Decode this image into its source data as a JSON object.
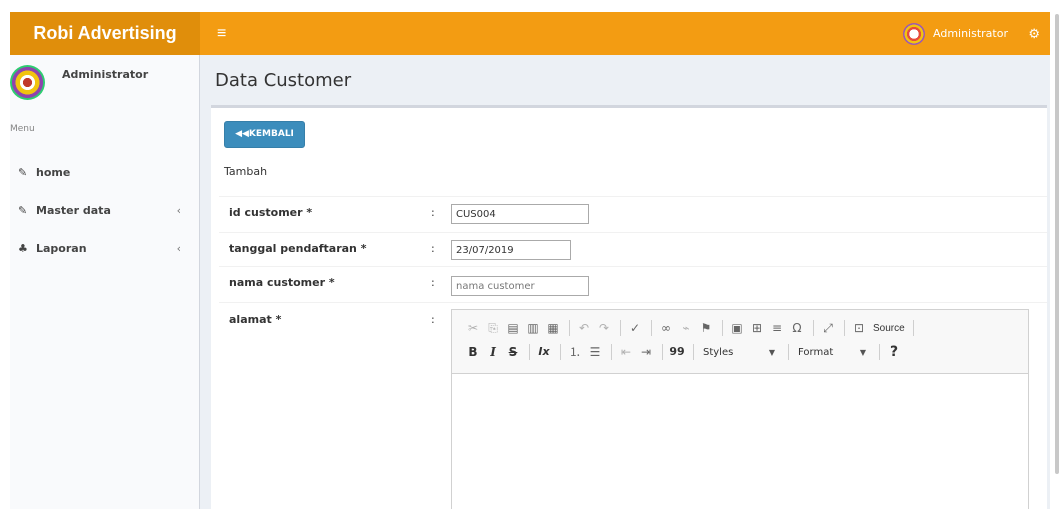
{
  "app": {
    "brand": "Robi Advertising",
    "menu_toggle_icon": "bars-icon",
    "header_user": "Administrator",
    "settings_icon": "gears-icon",
    "colors": {
      "header": "#f39c12",
      "logo": "#e08e0b",
      "primary_button": "#3c8dbc"
    }
  },
  "sidebar": {
    "user_name": "Administrator",
    "menu_header": "Menu",
    "items": [
      {
        "label": "home",
        "icon": "edit-icon",
        "icon_glyph": "✎",
        "chevron": ""
      },
      {
        "label": "Master data",
        "icon": "edit-icon",
        "icon_glyph": "✎",
        "chevron": "‹"
      },
      {
        "label": "Laporan",
        "icon": "sitemap-icon",
        "icon_glyph": "♣",
        "chevron": "‹"
      }
    ]
  },
  "page": {
    "title": "Data Customer",
    "back_button": "KEMBALI",
    "back_icon": "◀◀",
    "subtitle": "Tambah"
  },
  "form": {
    "id_customer": {
      "label": "id customer *",
      "value": "CUS004",
      "placeholder": ""
    },
    "tanggal_pendaftaran": {
      "label": "tanggal pendaftaran *",
      "value": "23/07/2019",
      "placeholder": ""
    },
    "nama_customer": {
      "label": "nama customer *",
      "value": "",
      "placeholder": "nama customer"
    },
    "alamat": {
      "label": "alamat *",
      "value": ""
    },
    "colon": ":"
  },
  "editor": {
    "source_label": "Source",
    "styles_label": "Styles",
    "format_label": "Format",
    "bold": "B",
    "italic": "I",
    "strike": "S",
    "remove_format": "Ix",
    "blockquote": "99",
    "help": "?"
  }
}
